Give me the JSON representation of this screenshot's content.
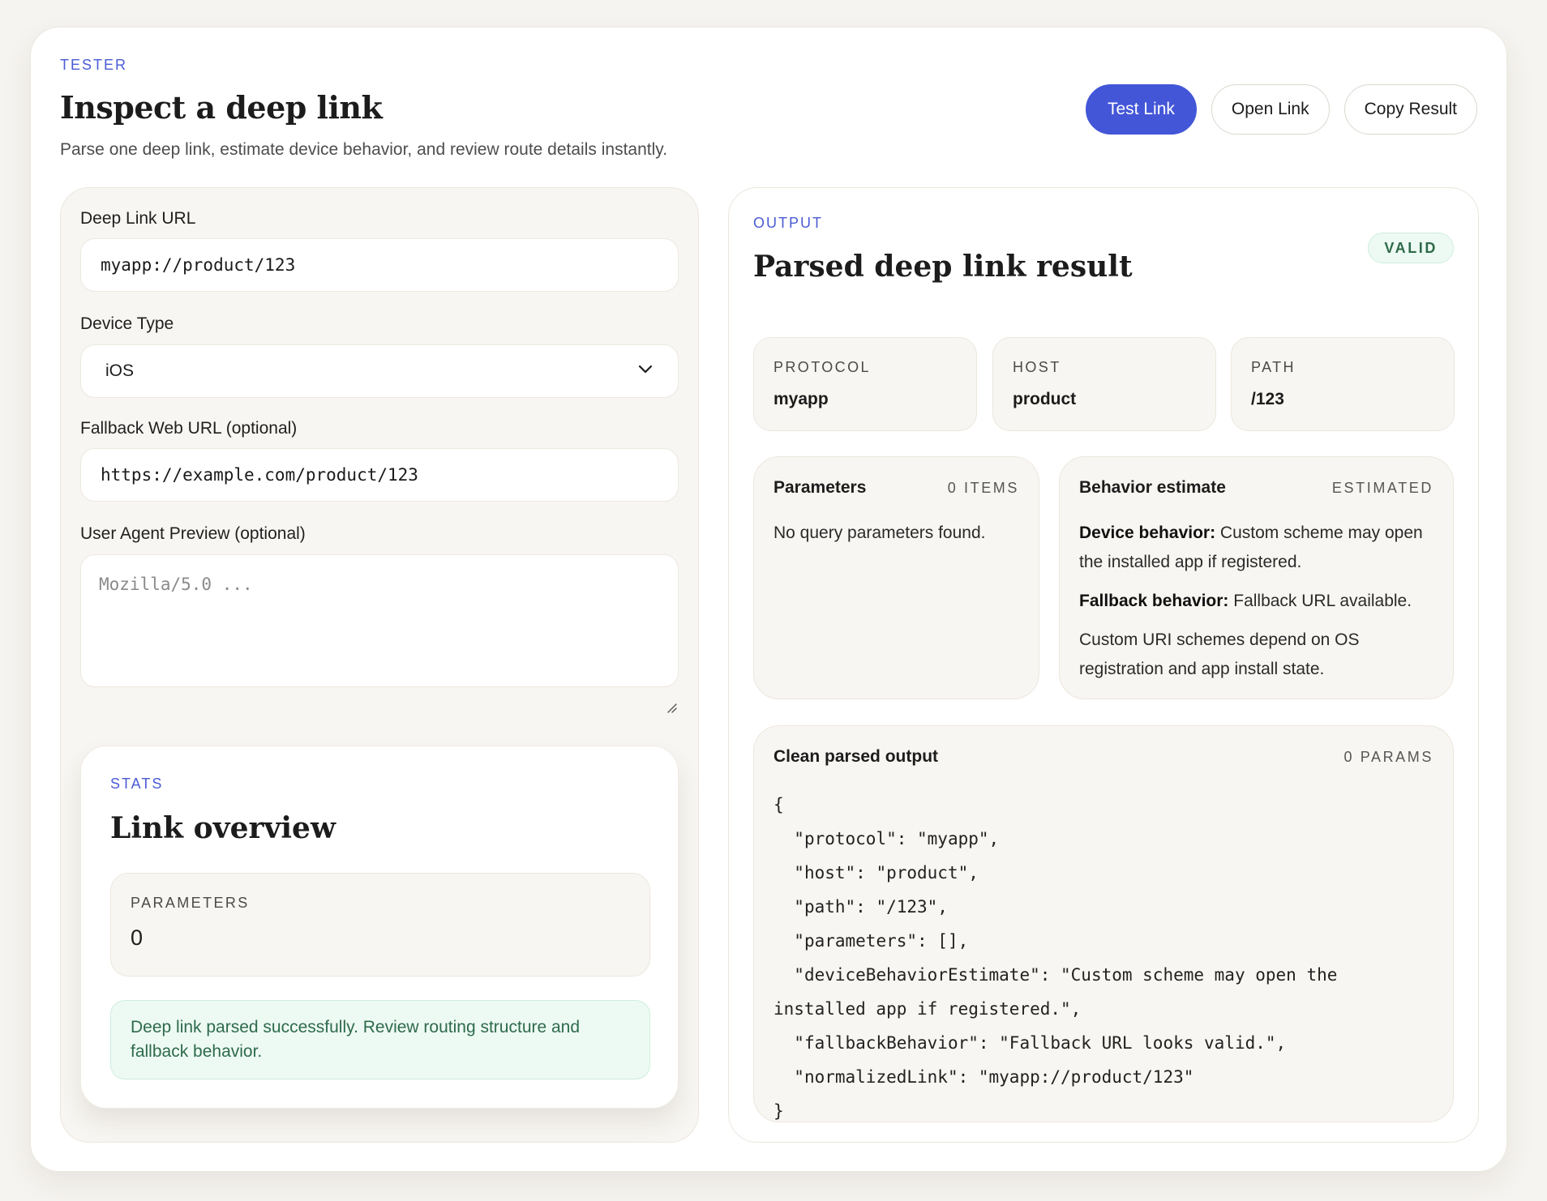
{
  "header": {
    "eyebrow": "TESTER",
    "title": "Inspect a deep link",
    "subtitle": "Parse one deep link, estimate device behavior, and review route details instantly.",
    "actions": [
      "Test Link",
      "Open Link",
      "Copy Result"
    ]
  },
  "form": {
    "url_label": "Deep Link URL",
    "url_value": "myapp://product/123",
    "device_label": "Device Type",
    "device_value": "iOS",
    "fallback_label": "Fallback Web URL (optional)",
    "fallback_value": "https://example.com/product/123",
    "ua_label": "User Agent Preview (optional)",
    "ua_placeholder": "Mozilla/5.0 ..."
  },
  "stats": {
    "eyebrow": "STATS",
    "title": "Link overview",
    "parameters_label": "PARAMETERS",
    "parameters_value": "0",
    "message": "Deep link parsed successfully. Review routing structure and fallback behavior."
  },
  "output": {
    "eyebrow": "OUTPUT",
    "title": "Parsed deep link result",
    "badge": "VALID",
    "protocol_label": "PROTOCOL",
    "protocol_value": "myapp",
    "host_label": "HOST",
    "host_value": "product",
    "path_label": "PATH",
    "path_value": "/123",
    "params_title": "Parameters",
    "params_meta": "0 ITEMS",
    "params_empty": "No query parameters found.",
    "behavior_title": "Behavior estimate",
    "behavior_meta": "ESTIMATED",
    "device_behavior_label": "Device behavior:",
    "device_behavior_text": " Custom scheme may open the installed app if registered.",
    "fallback_behavior_label": "Fallback behavior:",
    "fallback_behavior_text": " Fallback URL available.",
    "behavior_note": "Custom URI schemes depend on OS registration and app install state.",
    "clean_title": "Clean parsed output",
    "clean_meta": "0 PARAMS",
    "clean_json": "{\n  \"protocol\": \"myapp\",\n  \"host\": \"product\",\n  \"path\": \"/123\",\n  \"parameters\": [],\n  \"deviceBehaviorEstimate\": \"Custom scheme may open the installed app if registered.\",\n  \"fallbackBehavior\": \"Fallback URL looks valid.\",\n  \"normalizedLink\": \"myapp://product/123\"\n}"
  },
  "icons": {
    "select_caret": "chevron-down-icon",
    "textarea_grip": "resize-grip-icon"
  },
  "colors": {
    "accent": "#4356d8",
    "success_bg": "#edfaf3",
    "success_text": "#2e6a4b",
    "panel_bg": "#f8f6f2",
    "page_bg": "#f6f4f0"
  }
}
